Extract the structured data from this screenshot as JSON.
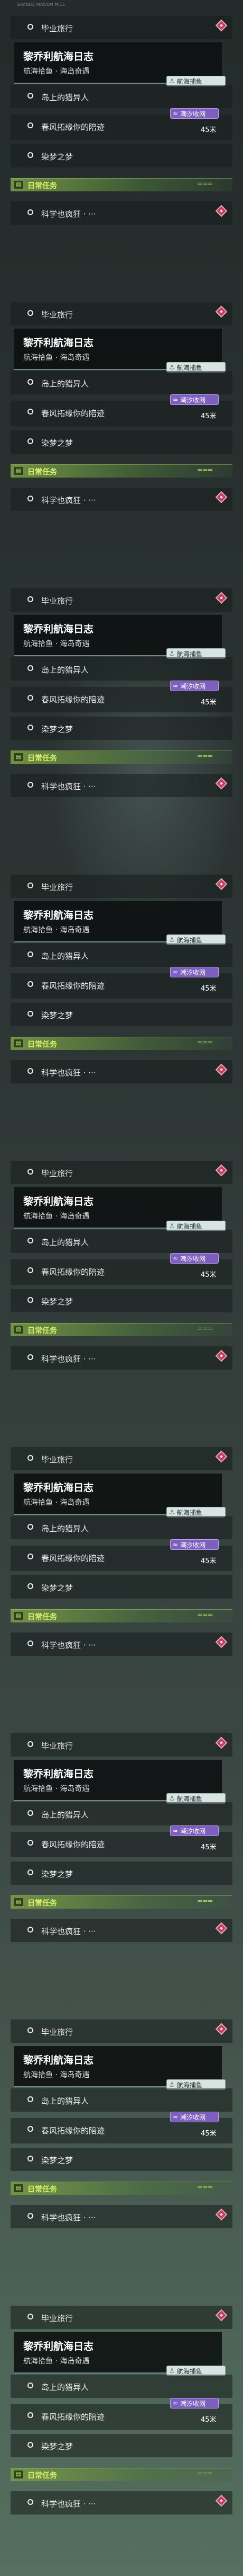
{
  "panels": [
    {
      "tagline": "GRANDE MAISON MICE",
      "tasks": {
        "graduation_trip": "毕业旅行",
        "island_hunter": "岛上的猎异人",
        "spring_wind": "春风拓缘你的陪迹",
        "dyed_dream": "染梦之梦",
        "science_crazy": "科学也疯狂 · ···"
      },
      "main_quest": {
        "title": "黎乔利航海日志",
        "subtitle": "航海拾鱼 · 海岛奇遇"
      },
      "badges": {
        "seaside": "航海捕鱼",
        "tide": "潮汐收网",
        "distance": "45米"
      },
      "daily_tasks": "日常任务"
    },
    {
      "tasks": {
        "graduation_trip": "毕业旅行",
        "island_hunter": "岛上的猎异人",
        "spring_wind": "春风拓缘你的陪迹",
        "dyed_dream": "染梦之梦",
        "science_crazy": "科学也疯狂 · ···"
      },
      "main_quest": {
        "title": "黎乔利航海日志",
        "subtitle": "航海拾鱼 · 海岛奇遇"
      },
      "badges": {
        "seaside": "航海捕鱼",
        "tide": "潮汐收网",
        "distance": "45米"
      },
      "daily_tasks": "日常任务"
    },
    {
      "tasks": {
        "graduation_trip": "毕业旅行",
        "island_hunter": "岛上的猎异人",
        "spring_wind": "春风拓缘你的陪迹",
        "dyed_dream": "染梦之梦",
        "science_crazy": "科学也疯狂 · ···"
      },
      "main_quest": {
        "title": "黎乔利航海日志",
        "subtitle": "航海拾鱼 · 海岛奇遇"
      },
      "badges": {
        "seaside": "航海捕鱼",
        "tide": "潮汐收网",
        "distance": "45米"
      },
      "daily_tasks": "日常任务"
    },
    {
      "tasks": {
        "graduation_trip": "毕业旅行",
        "island_hunter": "岛上的猎异人",
        "spring_wind": "春风拓缘你的陪迹",
        "dyed_dream": "染梦之梦",
        "science_crazy": "科学也疯狂 · ···"
      },
      "main_quest": {
        "title": "黎乔利航海日志",
        "subtitle": "航海拾鱼 · 海岛奇遇"
      },
      "badges": {
        "seaside": "航海捕鱼",
        "tide": "潮汐收网",
        "distance": "45米"
      },
      "daily_tasks": "日常任务"
    },
    {
      "tasks": {
        "graduation_trip": "毕业旅行",
        "island_hunter": "岛上的猎异人",
        "spring_wind": "春风拓缘你的陪迹",
        "dyed_dream": "染梦之梦",
        "science_crazy": "科学也疯狂 · ···"
      },
      "main_quest": {
        "title": "黎乔利航海日志",
        "subtitle": "航海拾鱼 · 海岛奇遇"
      },
      "badges": {
        "seaside": "航海捕鱼",
        "tide": "潮汐收网",
        "distance": "45米"
      },
      "daily_tasks": "日常任务"
    },
    {
      "tasks": {
        "graduation_trip": "毕业旅行",
        "island_hunter": "岛上的猎异人",
        "spring_wind": "春风拓缘你的陪迹",
        "dyed_dream": "染梦之梦",
        "science_crazy": "科学也疯狂 · ···"
      },
      "main_quest": {
        "title": "黎乔利航海日志",
        "subtitle": "航海拾鱼 · 海岛奇遇"
      },
      "badges": {
        "seaside": "航海捕鱼",
        "tide": "潮汐收网",
        "distance": "45米"
      },
      "daily_tasks": "日常任务"
    },
    {
      "tasks": {
        "graduation_trip": "毕业旅行",
        "island_hunter": "岛上的猎异人",
        "spring_wind": "春风拓缘你的陪迹",
        "dyed_dream": "染梦之梦",
        "science_crazy": "科学也疯狂 · ···"
      },
      "main_quest": {
        "title": "黎乔利航海日志",
        "subtitle": "航海拾鱼 · 海岛奇遇"
      },
      "badges": {
        "seaside": "航海捕鱼",
        "tide": "潮汐收网",
        "distance": "45米"
      },
      "daily_tasks": "日常任务"
    },
    {
      "tasks": {
        "graduation_trip": "毕业旅行",
        "island_hunter": "岛上的猎异人",
        "spring_wind": "春风拓缘你的陪迹",
        "dyed_dream": "染梦之梦",
        "science_crazy": "科学也疯狂 · ···"
      },
      "main_quest": {
        "title": "黎乔利航海日志",
        "subtitle": "航海拾鱼 · 海岛奇遇"
      },
      "badges": {
        "seaside": "航海捕鱼",
        "tide": "潮汐收网",
        "distance": "45米"
      },
      "daily_tasks": "日常任务"
    },
    {
      "tasks": {
        "graduation_trip": "毕业旅行",
        "island_hunter": "岛上的猎异人",
        "spring_wind": "春风拓缘你的陪迹",
        "dyed_dream": "染梦之梦",
        "science_crazy": "科学也疯狂 · ···"
      },
      "main_quest": {
        "title": "黎乔利航海日志",
        "subtitle": "航海拾鱼 · 海岛奇遇"
      },
      "badges": {
        "seaside": "航海捕鱼",
        "tide": "潮汐收网",
        "distance": "45米"
      },
      "daily_tasks": "日常任务"
    }
  ],
  "colors": {
    "tide_badge": "#7d5fbf",
    "daily_banner": "#d9f06a",
    "marker": "#c04060",
    "underline": "#6f8a86"
  },
  "icons": {
    "task_bullet": "circle-outline-icon",
    "marker": "diamond-marker-icon",
    "seaside": "boat-icon",
    "tide": "wave-icon",
    "daily": "calendar-icon"
  }
}
